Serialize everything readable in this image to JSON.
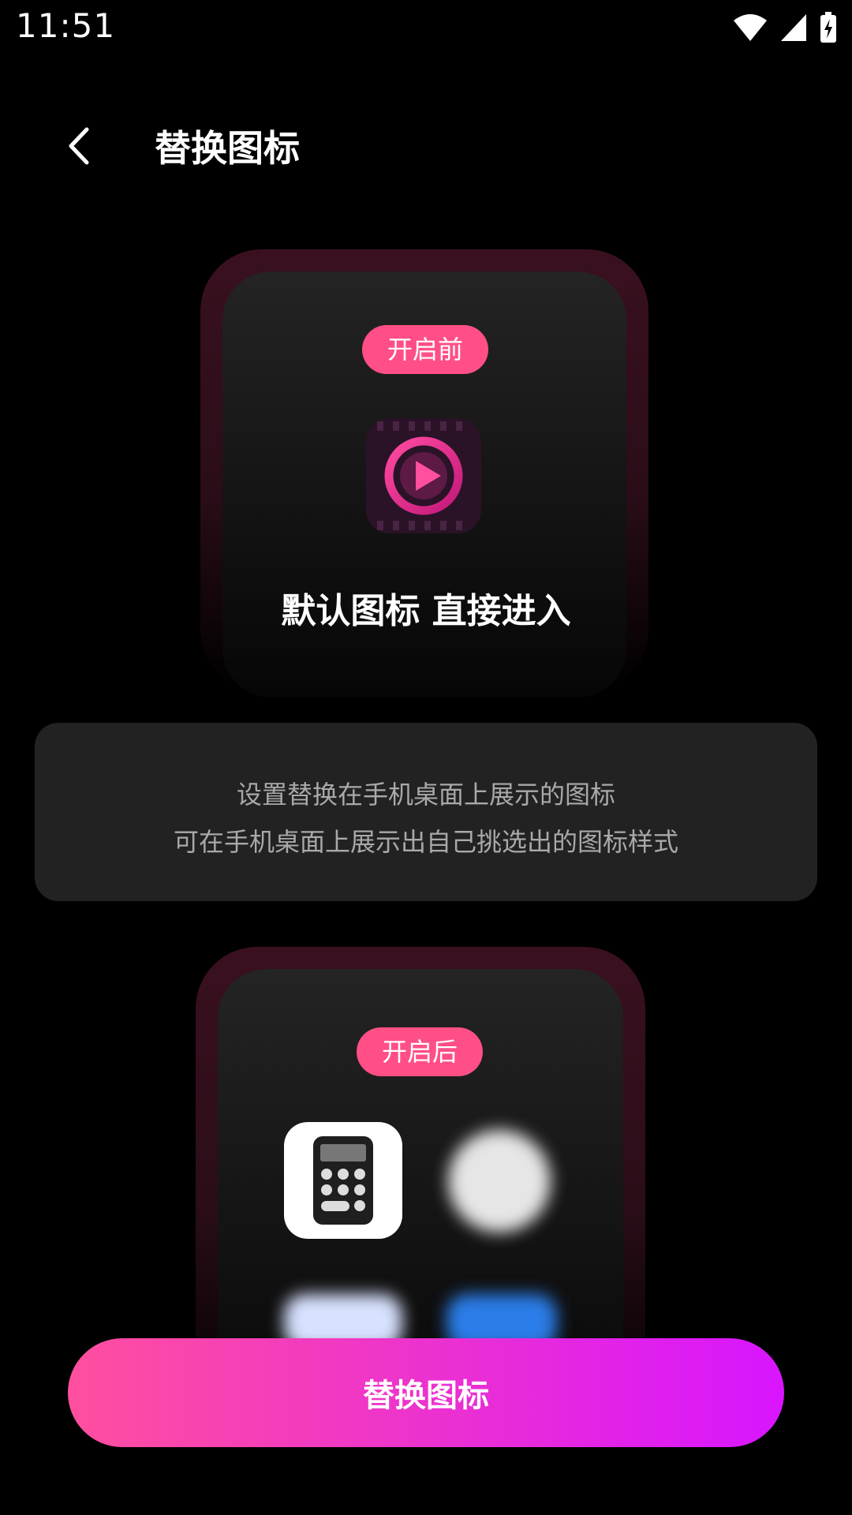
{
  "status_bar": {
    "time": "11:51",
    "icons": [
      "wifi-icon",
      "cellular-signal-icon",
      "battery-charging-icon"
    ]
  },
  "header": {
    "back_icon": "chevron-left-icon",
    "title": "替换图标"
  },
  "before_section": {
    "badge": "开启前",
    "app_icon": "play-circle-film-icon",
    "caption": "默认图标 直接进入"
  },
  "info_card": {
    "line1": "设置替换在手机桌面上展示的图标",
    "line2": "可在手机桌面上展示出自己挑选出的图标样式"
  },
  "after_section": {
    "badge": "开启后",
    "icons": [
      "calculator-icon",
      "blurred-app-icon",
      "blurred-app-icon",
      "blurred-app-icon"
    ]
  },
  "primary_button": {
    "label": "替换图标"
  },
  "colors": {
    "accent_pink": "#ff4f86",
    "button_gradient_start": "#ff4f9e",
    "button_gradient_end": "#d915ff",
    "background": "#000000",
    "card_background": "#222222"
  }
}
